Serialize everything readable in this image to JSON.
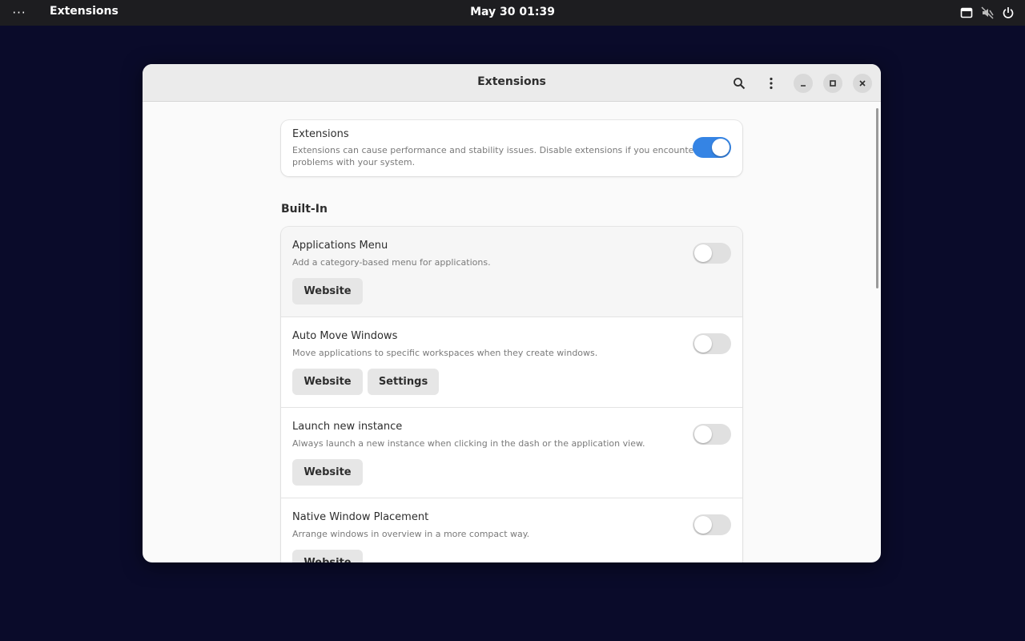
{
  "topbar": {
    "activities": "···",
    "app_menu": "Extensions",
    "clock": "May 30  01:39",
    "tray_icons": [
      "screen-icon",
      "mute-icon",
      "power-icon"
    ]
  },
  "window": {
    "title": "Extensions",
    "header_buttons": [
      "search-icon",
      "menu-icon",
      "minimize-icon",
      "maximize-icon",
      "close-icon"
    ]
  },
  "master": {
    "title": "Extensions",
    "subtitle_line1": "Extensions can cause performance and stability issues. Disable extensions if you encounter",
    "subtitle_line2": "problems with your system.",
    "enabled": true
  },
  "section": {
    "title": "Built-In"
  },
  "extensions": [
    {
      "title": "Applications Menu",
      "subtitle": "Add a category-based menu for applications.",
      "enabled": false,
      "website_label": "Website"
    },
    {
      "title": "Auto Move Windows",
      "subtitle": "Move applications to specific workspaces when they create windows.",
      "enabled": false,
      "website_label": "Website",
      "settings_label": "Settings"
    },
    {
      "title": "Launch new instance",
      "subtitle": "Always launch a new instance when clicking in the dash or the application view.",
      "enabled": false,
      "website_label": "Website"
    },
    {
      "title": "Native Window Placement",
      "subtitle": "Arrange windows in overview in a more compact way.",
      "enabled": false,
      "website_label": "Website"
    }
  ],
  "colors": {
    "accent": "#3584e4",
    "desktop": "#0a0b2a",
    "topbar": "#1d1d20"
  }
}
